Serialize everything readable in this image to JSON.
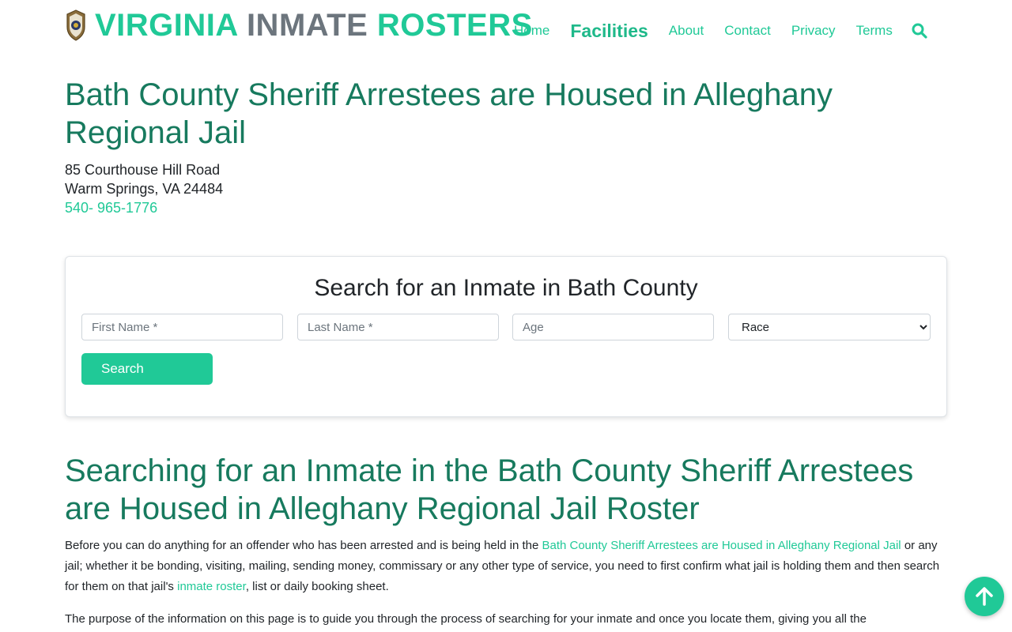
{
  "header": {
    "brand_part1": "VIRGINIA",
    "brand_part2": "INMATE",
    "brand_part3": "ROSTERS",
    "nav": {
      "home": "Home",
      "facilities": "Facilities",
      "about": "About",
      "contact": "Contact",
      "privacy": "Privacy",
      "terms": "Terms"
    },
    "search_icon": "search-icon"
  },
  "page": {
    "title": "Bath County Sheriff Arrestees are Housed in Alleghany Regional Jail",
    "address_line1": "85 Courthouse Hill Road",
    "address_line2": "Warm Springs, VA 24484",
    "phone": "540- 965-1776"
  },
  "search_form": {
    "heading": "Search for an Inmate in Bath County",
    "first_name_placeholder": "First Name *",
    "last_name_placeholder": "Last Name *",
    "age_placeholder": "Age",
    "race_selected": "Race",
    "button_label": "Search"
  },
  "content": {
    "section_heading": "Searching for an Inmate in the Bath County Sheriff Arrestees are Housed in Alleghany Regional Jail Roster",
    "p1_a": "Before you can do anything for an offender who has been arrested and is being held in the ",
    "p1_link1": "Bath County Sheriff Arrestees are Housed in Alleghany Regional Jail",
    "p1_b": " or any jail; whether it be bonding, visiting, mailing, sending money, commissary or any other type of service, you need to first confirm what jail is holding them and then search for them on that jail's ",
    "p1_link2": "inmate roster",
    "p1_c": ", list or daily booking sheet.",
    "p2": "The purpose of the information on this page is to guide you through the process of searching for your inmate and once you locate them, giving you all the"
  },
  "colors": {
    "accent": "#20c997",
    "heading": "#177a5e",
    "muted": "#6c757d"
  }
}
